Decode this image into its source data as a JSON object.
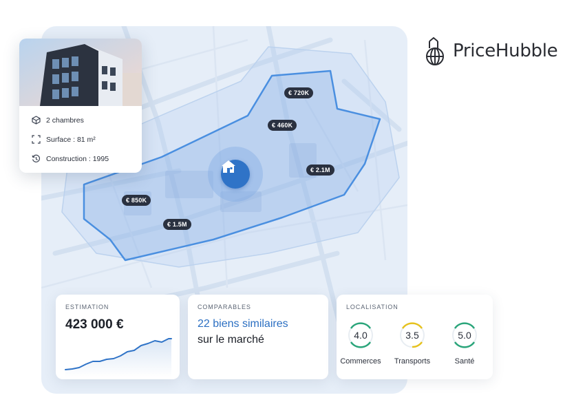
{
  "brand": {
    "name": "PriceHubble",
    "logo_icon": "globe-house-icon"
  },
  "property": {
    "features": [
      {
        "icon": "bed-icon",
        "label": "2 chambres"
      },
      {
        "icon": "expand-icon",
        "label": "Surface : 81 m²"
      },
      {
        "icon": "history-icon",
        "label": "Construction : 1995"
      }
    ]
  },
  "map": {
    "home_icon": "home-icon",
    "price_pins": [
      "€ 720K",
      "€ 460K",
      "€ 2.1M",
      "€ 850K",
      "€ 1.5M"
    ]
  },
  "estimation": {
    "title": "ESTIMATION",
    "value": "423 000 €",
    "trend_color": "#2f73c7"
  },
  "comparables": {
    "title": "COMPARABLES",
    "highlight": "22 biens similaires",
    "subtitle": "sur le marché",
    "highlight_color": "#2b6fc2"
  },
  "localisation": {
    "title": "LOCALISATION",
    "scores": [
      {
        "value": "4.0",
        "label": "Commerces",
        "color": "#2aa57a"
      },
      {
        "value": "3.5",
        "label": "Transports",
        "color": "#e6c21e"
      },
      {
        "value": "5.0",
        "label": "Santé",
        "color": "#2aa57a"
      }
    ]
  }
}
